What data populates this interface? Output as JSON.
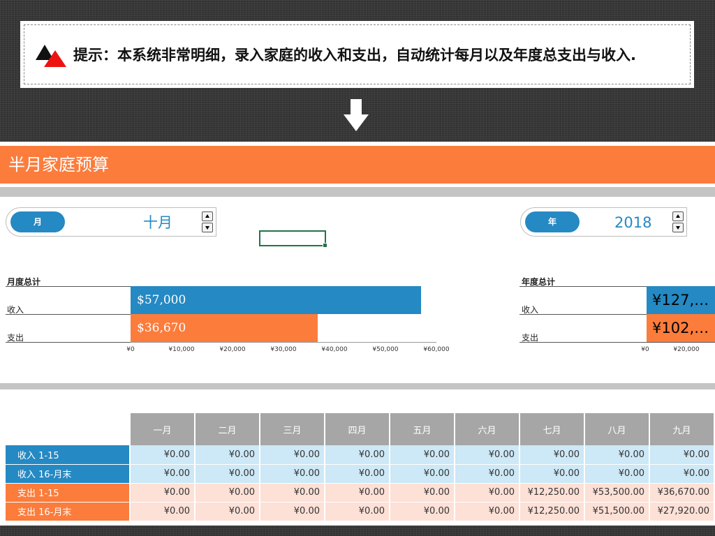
{
  "tip": {
    "text": "提示：本系统非常明细，录入家庭的收入和支出，自动统计每月以及年度总支出与收入."
  },
  "header": {
    "title": "半月家庭预算"
  },
  "month_control": {
    "label": "月",
    "value": "十月"
  },
  "year_control": {
    "label": "年",
    "value": "2018"
  },
  "monthly": {
    "title": "月度总计",
    "income_label": "收入",
    "expense_label": "支出",
    "income_value": "$57,000",
    "expense_value": "$36,670",
    "ticks": [
      "¥0",
      "¥10,000",
      "¥20,000",
      "¥30,000",
      "¥40,000",
      "¥50,000",
      "¥60,000"
    ]
  },
  "yearly": {
    "title": "年度总计",
    "income_label": "收入",
    "expense_label": "支出",
    "income_value": "¥127,…",
    "expense_value": "¥102,…",
    "ticks": [
      "¥0",
      "¥20,000"
    ]
  },
  "chart_data": [
    {
      "type": "bar",
      "title": "月度总计",
      "categories": [
        "收入",
        "支出"
      ],
      "values": [
        57000,
        36670
      ],
      "xlim": [
        0,
        60000
      ],
      "colors": [
        "#2589c3",
        "#fc7c3c"
      ]
    }
  ],
  "table": {
    "columns": [
      "一月",
      "二月",
      "三月",
      "四月",
      "五月",
      "六月",
      "七月",
      "八月",
      "九月"
    ],
    "rows": [
      {
        "label": "收入 1-15",
        "kind": "inc",
        "cells": [
          "¥0.00",
          "¥0.00",
          "¥0.00",
          "¥0.00",
          "¥0.00",
          "¥0.00",
          "¥0.00",
          "¥0.00",
          "¥0.00"
        ]
      },
      {
        "label": "收入 16-月末",
        "kind": "inc",
        "cells": [
          "¥0.00",
          "¥0.00",
          "¥0.00",
          "¥0.00",
          "¥0.00",
          "¥0.00",
          "¥0.00",
          "¥0.00",
          "¥0.00"
        ]
      },
      {
        "label": "支出 1-15",
        "kind": "exp",
        "cells": [
          "¥0.00",
          "¥0.00",
          "¥0.00",
          "¥0.00",
          "¥0.00",
          "¥0.00",
          "¥12,250.00",
          "¥53,500.00",
          "¥36,670.00"
        ]
      },
      {
        "label": "支出 16-月末",
        "kind": "exp",
        "cells": [
          "¥0.00",
          "¥0.00",
          "¥0.00",
          "¥0.00",
          "¥0.00",
          "¥0.00",
          "¥12,250.00",
          "¥51,500.00",
          "¥27,920.00"
        ]
      }
    ]
  },
  "colors": {
    "accent_orange": "#fc7c3c",
    "accent_blue": "#2589c3"
  }
}
